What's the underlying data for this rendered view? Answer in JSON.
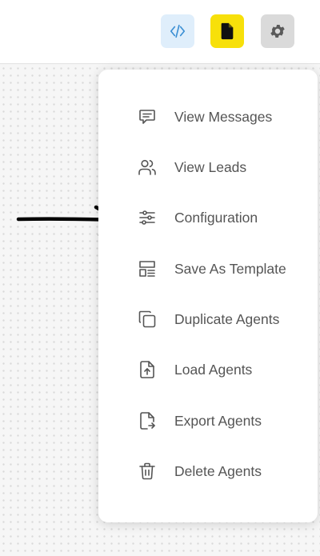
{
  "toolbar": {
    "buttons": [
      {
        "icon": "code-icon",
        "color": "#dfeefb",
        "icon_color": "#3b8fd4"
      },
      {
        "icon": "document-icon",
        "color": "#f7e00a",
        "icon_color": "#111111"
      },
      {
        "icon": "gear-icon",
        "color": "#dadada",
        "icon_color": "#5a5a5a"
      }
    ]
  },
  "menu": {
    "items": [
      {
        "label": "View Messages",
        "icon": "message-icon"
      },
      {
        "label": "View Leads",
        "icon": "users-icon"
      },
      {
        "label": "Configuration",
        "icon": "sliders-icon"
      },
      {
        "label": "Save As Template",
        "icon": "template-icon"
      },
      {
        "label": "Duplicate Agents",
        "icon": "duplicate-icon"
      },
      {
        "label": "Load Agents",
        "icon": "upload-file-icon"
      },
      {
        "label": "Export Agents",
        "icon": "export-file-icon"
      },
      {
        "label": "Delete Agents",
        "icon": "trash-icon"
      }
    ]
  },
  "annotation": {
    "icon": "arrow-right-icon",
    "color": "#000000"
  }
}
